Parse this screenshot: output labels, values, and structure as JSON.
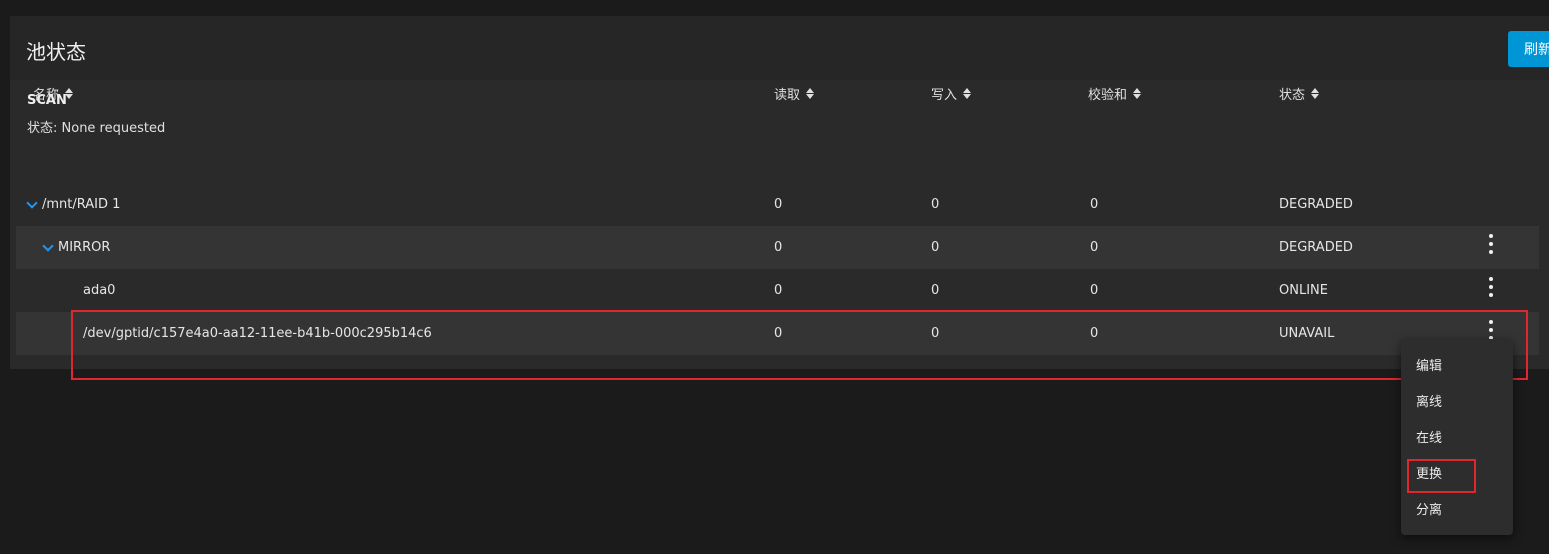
{
  "header": {
    "title": "池状态",
    "refresh_label": "刷新"
  },
  "scan": {
    "title": "SCAN",
    "status": "状态: None requested"
  },
  "columns": [
    "名称",
    "读取",
    "写入",
    "校验和",
    "状态"
  ],
  "rows": [
    {
      "name": "/mnt/RAID 1",
      "read": "0",
      "write": "0",
      "checksum": "0",
      "status": "DEGRADED"
    },
    {
      "name": "MIRROR",
      "read": "0",
      "write": "0",
      "checksum": "0",
      "status": "DEGRADED"
    },
    {
      "name": "ada0",
      "read": "0",
      "write": "0",
      "checksum": "0",
      "status": "ONLINE"
    },
    {
      "name": "/dev/gptid/c157e4a0-aa12-11ee-b41b-000c295b14c6",
      "read": "0",
      "write": "0",
      "checksum": "0",
      "status": "UNAVAIL"
    }
  ],
  "context_menu": {
    "items": [
      "编辑",
      "离线",
      "在线",
      "更换",
      "分离"
    ]
  },
  "colors": {
    "accent": "#0095d5",
    "chevron": "#2196f3",
    "highlight_border": "#e0262f"
  }
}
